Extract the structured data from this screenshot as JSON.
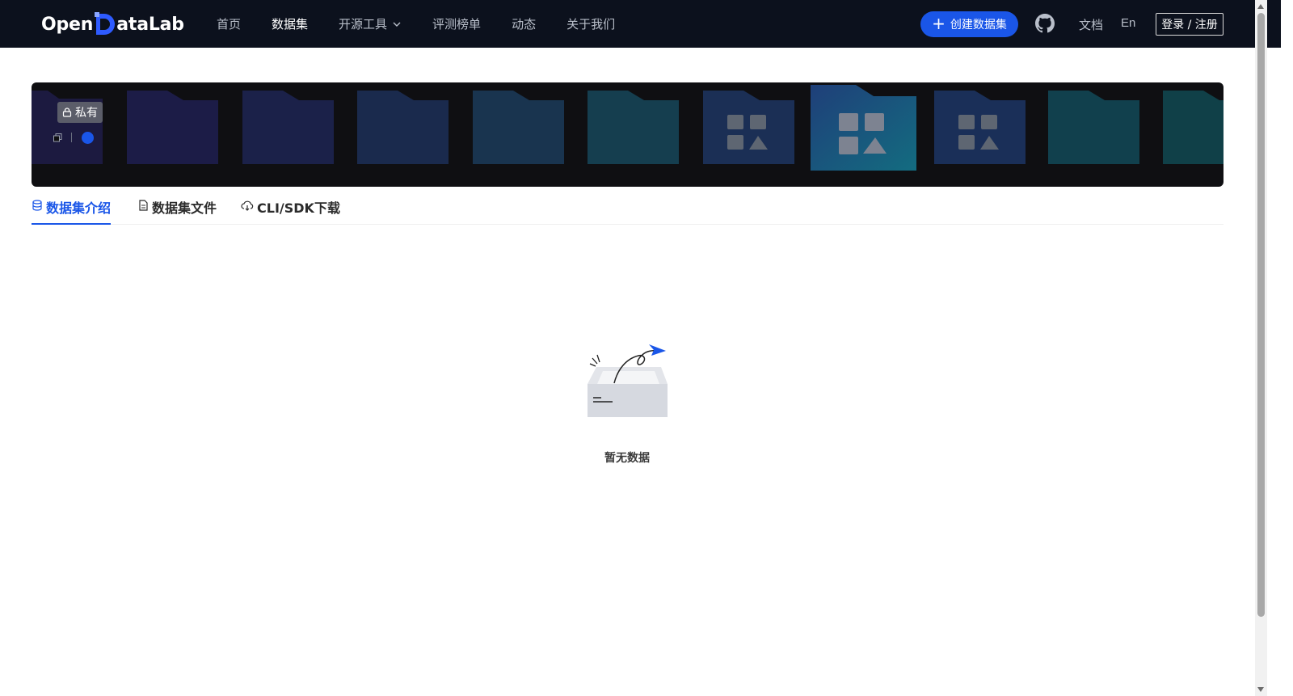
{
  "nav": {
    "logo_text_left": "Open",
    "logo_text_right": "ataLab",
    "items": [
      {
        "label": "首页"
      },
      {
        "label": "数据集"
      },
      {
        "label": "开源工具"
      },
      {
        "label": "评测榜单"
      },
      {
        "label": "动态"
      },
      {
        "label": "关于我们"
      }
    ],
    "create_label": "创建数据集",
    "docs_label": "文档",
    "lang_label": "En",
    "login_label": "登录 / 注册"
  },
  "banner": {
    "private_label": "私有"
  },
  "tabs": [
    {
      "label": "数据集介绍"
    },
    {
      "label": "数据集文件"
    },
    {
      "label": "CLI/SDK下载"
    }
  ],
  "empty": {
    "label": "暂无数据"
  },
  "colors": {
    "brand": "#1a56e8",
    "topbar_bg": "#0c111d",
    "banner_bg": "#0f0f12"
  }
}
